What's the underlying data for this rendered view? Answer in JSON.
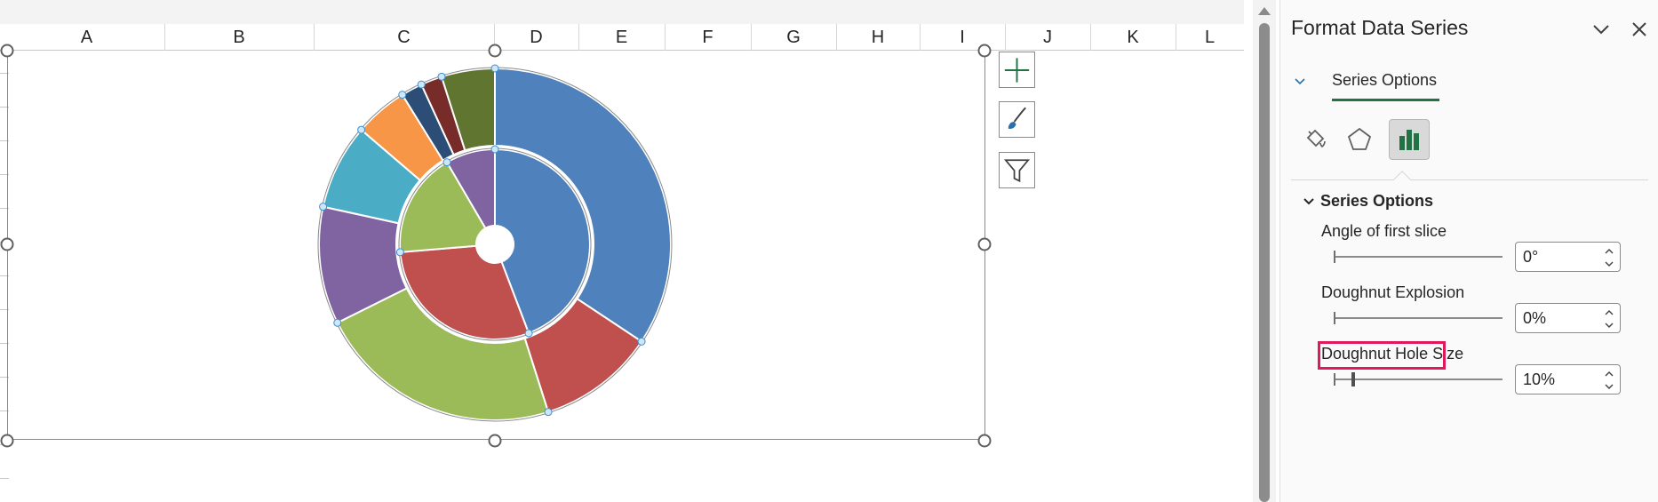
{
  "sheet": {
    "columns": [
      "A",
      "B",
      "C",
      "D",
      "E",
      "F",
      "G",
      "H",
      "I",
      "J",
      "K",
      "L"
    ]
  },
  "chart": {
    "type": "doughnut",
    "hole_size_pct": 10,
    "outer_ring": [
      {
        "value": 35,
        "color": "#4F81BD"
      },
      {
        "value": 11,
        "color": "#C0504D"
      },
      {
        "value": 23,
        "color": "#9BBB59"
      },
      {
        "value": 11,
        "color": "#8064A2"
      },
      {
        "value": 8,
        "color": "#4BACC6"
      },
      {
        "value": 5,
        "color": "#F79646"
      },
      {
        "value": 2,
        "color": "#2C4D75"
      },
      {
        "value": 2,
        "color": "#772C2A"
      },
      {
        "value": 5,
        "color": "#5F7530"
      }
    ],
    "inner_ring": [
      {
        "value": 42,
        "color": "#4F81BD"
      },
      {
        "value": 28,
        "color": "#C0504D"
      },
      {
        "value": 17,
        "color": "#9BBB59"
      },
      {
        "value": 8,
        "color": "#8064A2"
      }
    ],
    "side_buttons": [
      {
        "name": "chart-elements-button",
        "icon": "plus-icon"
      },
      {
        "name": "chart-styles-button",
        "icon": "brush-icon"
      },
      {
        "name": "chart-filters-button",
        "icon": "filter-icon"
      }
    ]
  },
  "pane": {
    "title": "Format Data Series",
    "tab_label": "Series Options",
    "section_label": "Series Options",
    "accent_color": "#217346",
    "highlight_color": "#E0195A",
    "options": [
      {
        "label": "Angle of first slice",
        "value": "0°",
        "slider_fraction": 0.0
      },
      {
        "label": "Doughnut Explosion",
        "value": "0%",
        "slider_fraction": 0.0
      },
      {
        "label": "Doughnut Hole Size",
        "value": "10%",
        "slider_fraction": 0.0
      }
    ]
  }
}
